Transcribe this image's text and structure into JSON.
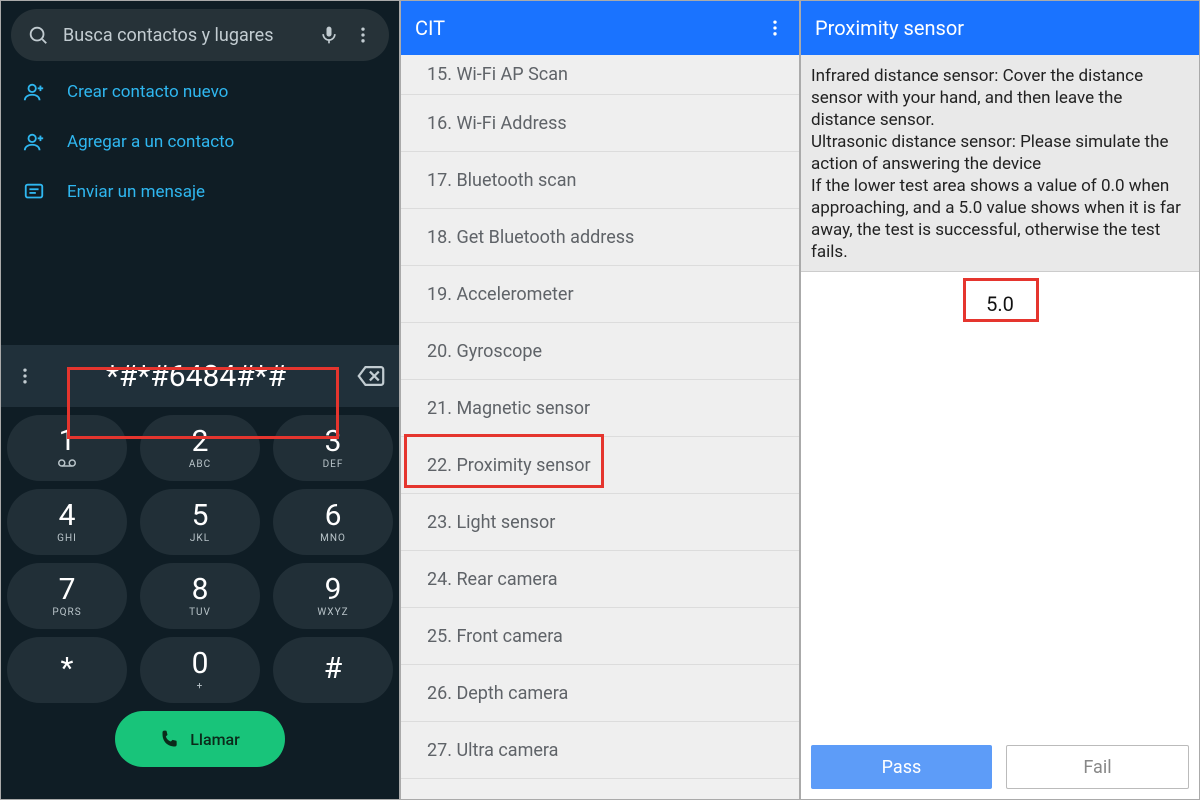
{
  "highlight_color": "#e5352e",
  "panel1": {
    "search_placeholder": "Busca contactos y lugares",
    "menu": [
      {
        "icon": "add-person",
        "label": "Crear contacto nuevo"
      },
      {
        "icon": "add-person",
        "label": "Agregar a un contacto"
      },
      {
        "icon": "message",
        "label": "Enviar un mensaje"
      }
    ],
    "dial_code": "*#*#6484#*#",
    "keypad": [
      [
        {
          "d": "1",
          "l": "∞"
        },
        {
          "d": "2",
          "l": "ABC"
        },
        {
          "d": "3",
          "l": "DEF"
        }
      ],
      [
        {
          "d": "4",
          "l": "GHI"
        },
        {
          "d": "5",
          "l": "JKL"
        },
        {
          "d": "6",
          "l": "MNO"
        }
      ],
      [
        {
          "d": "7",
          "l": "PQRS"
        },
        {
          "d": "8",
          "l": "TUV"
        },
        {
          "d": "9",
          "l": "WXYZ"
        }
      ],
      [
        {
          "d": "*",
          "l": ""
        },
        {
          "d": "0",
          "l": "+"
        },
        {
          "d": "#",
          "l": ""
        }
      ]
    ],
    "call_label": "Llamar"
  },
  "panel2": {
    "title": "CIT",
    "items": [
      "15. Wi-Fi AP Scan",
      "16. Wi-Fi Address",
      "17. Bluetooth scan",
      "18. Get Bluetooth address",
      "19. Accelerometer",
      "20. Gyroscope",
      "21. Magnetic sensor",
      "22. Proximity sensor",
      "23. Light sensor",
      "24. Rear camera",
      "25. Front camera",
      "26. Depth camera",
      "27. Ultra camera"
    ],
    "highlight_index": 7
  },
  "panel3": {
    "title": "Proximity sensor",
    "instructions": "Infrared distance sensor: Cover the distance sensor with your hand, and then leave the distance sensor.\n Ultrasonic distance sensor: Please simulate the action of answering the device\n If the lower test area shows a value of 0.0 when approaching, and a 5.0 value shows when it is far away, the test is successful, otherwise the test fails.",
    "reading": "5.0",
    "pass_label": "Pass",
    "fail_label": "Fail"
  }
}
